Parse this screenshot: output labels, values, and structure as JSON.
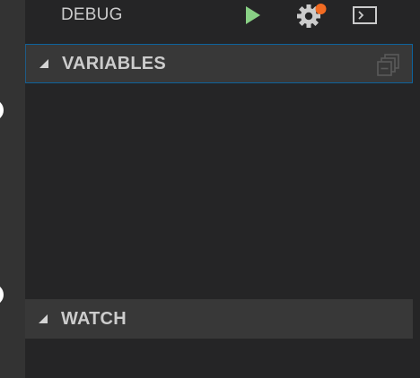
{
  "title": "DEBUG",
  "sections": {
    "variables": "VARIABLES",
    "watch": "WATCH"
  },
  "icons": {
    "start": "play-icon",
    "config": "gear-icon",
    "console": "terminal-icon",
    "collapse": "collapse-all-icon"
  },
  "colors": {
    "start": "#89d185",
    "badge": "#f26b22",
    "focus_border": "#0e639c"
  }
}
